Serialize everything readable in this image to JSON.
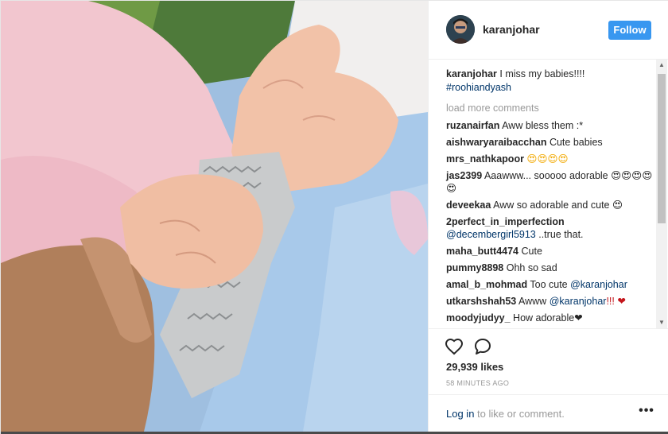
{
  "post": {
    "username": "karanjohar",
    "follow_label": "Follow",
    "photo_alt": "Baby hands holding"
  },
  "caption": {
    "user": "karanjohar",
    "text": " I miss my babies!!!!",
    "hashtag": "#roohiandyash"
  },
  "load_more": "load more comments",
  "comments": [
    {
      "user": "ruzanairfan",
      "text": " Aww bless them :*"
    },
    {
      "user": "aishwaryaraibacchan",
      "text": " Cute babies"
    },
    {
      "user": "mrs_nathkapoor",
      "text": " 😍😍😍😍"
    },
    {
      "user": "jas2399",
      "text": " Aaawww... sooooo adorable 😍😍😍😍😍"
    },
    {
      "user": "deveekaa",
      "text": " Aww so adorable and cute 😍"
    },
    {
      "user": "2perfect_in_imperfection",
      "text": " ",
      "mention": "@decembergirl5913",
      "suffix": " ..true that."
    },
    {
      "user": "maha_butt4474",
      "text": " Cute"
    },
    {
      "user": "pummy8898",
      "text": " Ohh so sad"
    },
    {
      "user": "amal_b_mohmad",
      "text": " Too cute ",
      "mention": "@karanjohar",
      "suffix": ""
    },
    {
      "user": "utkarshshah53",
      "text": " Awww ",
      "mention": "@karanjohar",
      "suffix": "!!! ❤"
    },
    {
      "user": "moodyjudyy_",
      "text": "  How adorable❤",
      "mention": "",
      "suffix": ""
    }
  ],
  "likes": "29,939 likes",
  "time": "58 MINUTES AGO",
  "footer": {
    "login": "Log in",
    "rest": " to like or comment.",
    "more": "•••"
  },
  "icons": {
    "like": "heart-outline-icon",
    "comment": "speech-bubble-icon",
    "more": "ellipsis-icon",
    "scroll_up": "scroll-up-arrow-icon",
    "scroll_down": "scroll-down-arrow-icon"
  },
  "colors": {
    "follow_bg": "#3897f0",
    "link": "#003569",
    "muted": "#999999"
  }
}
